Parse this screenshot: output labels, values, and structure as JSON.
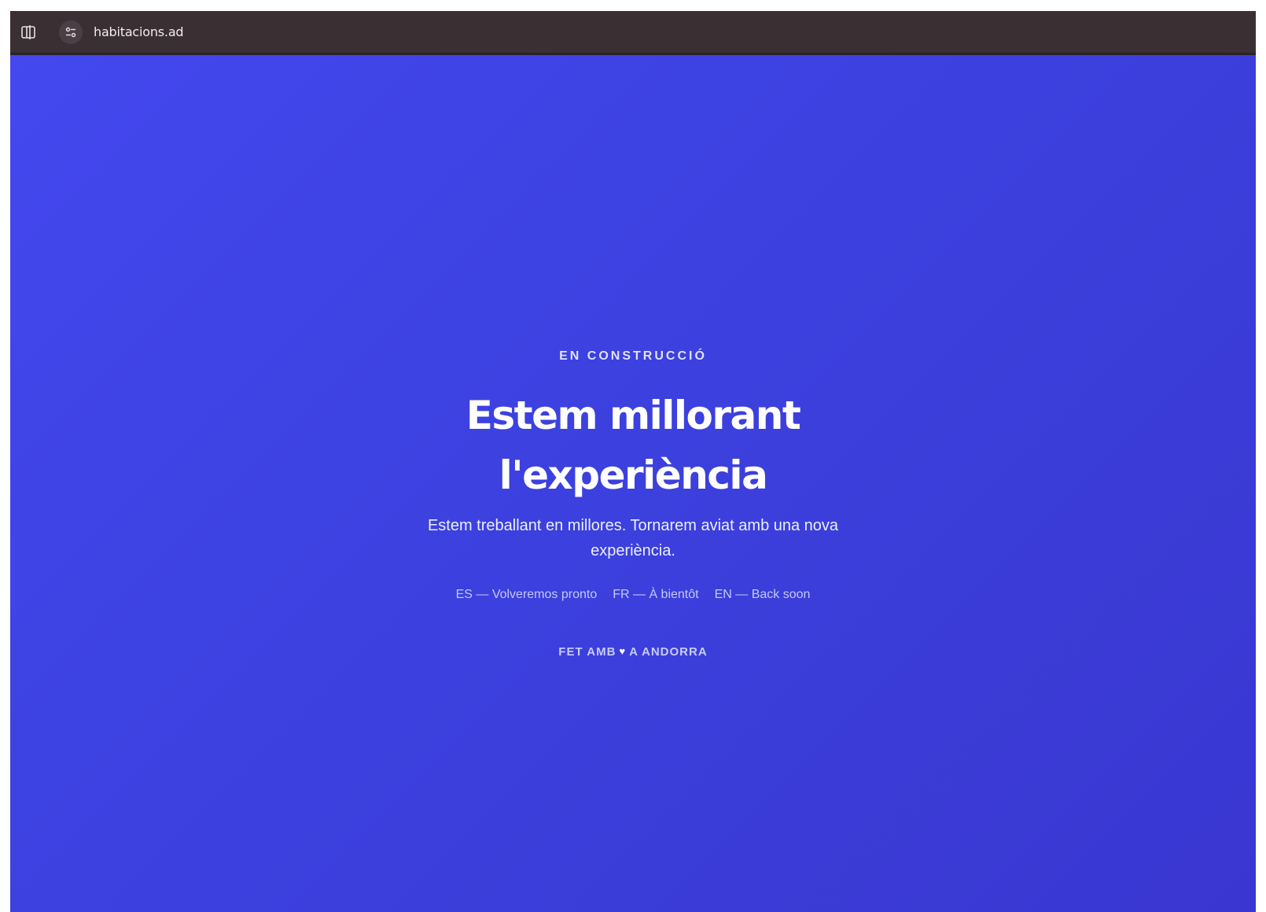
{
  "browser": {
    "url": "habitacions.ad",
    "sidebar_toggle_icon": "sidebar-toggle-icon",
    "site_info_icon": "site-settings-icon"
  },
  "hero": {
    "eyebrow": "EN CONSTRUCCIÓ",
    "headline_line1": "Estem millorant",
    "headline_line2": "l'experiència",
    "subtext": "Estem treballant en millores. Tornarem aviat amb una nova experiència.",
    "languages": [
      "ES — Volveremos pronto",
      "FR — À bientôt",
      "EN — Back soon"
    ],
    "footer_prefix": "FET AMB",
    "footer_icon": "heart-icon",
    "footer_suffix": "A ANDORRA"
  },
  "colors": {
    "background": "#3b3fd9",
    "browser_bar": "#3a2f33",
    "text_primary": "#ffffff"
  }
}
